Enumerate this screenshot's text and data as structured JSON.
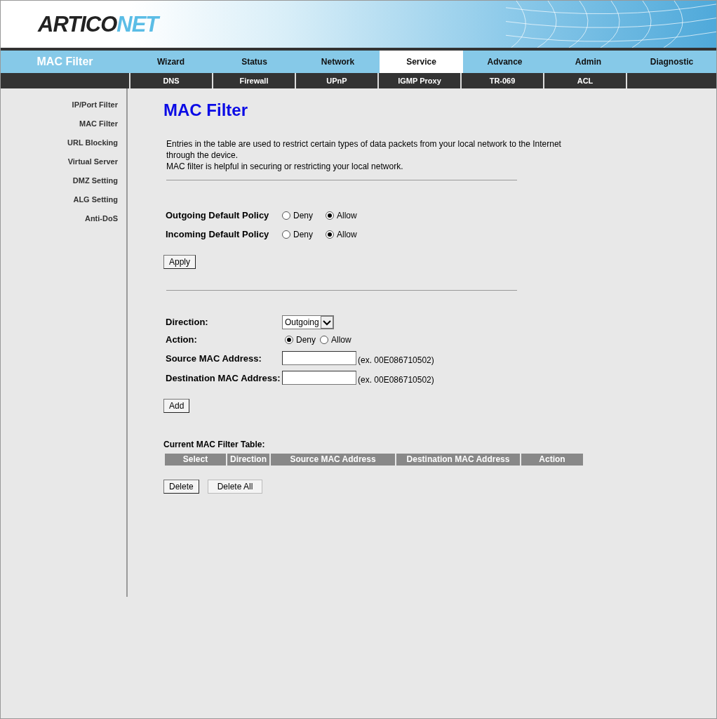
{
  "logo": {
    "dark": "ARTICO",
    "light": "NET"
  },
  "nav": {
    "section": "MAC Filter",
    "tabs": [
      {
        "label": "Wizard",
        "selected": false
      },
      {
        "label": "Status",
        "selected": false
      },
      {
        "label": "Network",
        "selected": false
      },
      {
        "label": "Service",
        "selected": true
      },
      {
        "label": "Advance",
        "selected": false
      },
      {
        "label": "Admin",
        "selected": false
      },
      {
        "label": "Diagnostic",
        "selected": false
      }
    ]
  },
  "subnav": [
    "DNS",
    "Firewall",
    "UPnP",
    "IGMP Proxy",
    "TR-069",
    "ACL"
  ],
  "sidebar": {
    "items": [
      "IP/Port Filter",
      "MAC Filter",
      "URL Blocking",
      "Virtual Server",
      "DMZ Setting",
      "ALG Setting",
      "Anti-DoS"
    ]
  },
  "title": "MAC Filter",
  "description": [
    "Entries in the table are used to restrict certain types of data packets from your local network to the Internet through the device.",
    "MAC filter is helpful in securing or restricting your local network."
  ],
  "policies": [
    {
      "label": "Outgoing Default Policy",
      "options": [
        {
          "label": "Deny",
          "selected": false
        },
        {
          "label": "Allow",
          "selected": true
        }
      ]
    },
    {
      "label": "Incoming Default Policy",
      "options": [
        {
          "label": "Deny",
          "selected": false
        },
        {
          "label": "Allow",
          "selected": true
        }
      ]
    }
  ],
  "apply_button": "Apply",
  "form": {
    "direction": {
      "label": "Direction:",
      "value": "Outgoing"
    },
    "action": {
      "label": "Action:",
      "options": [
        {
          "label": "Deny",
          "selected": true
        },
        {
          "label": "Allow",
          "selected": false
        }
      ]
    },
    "fields": [
      {
        "label": "Source MAC Address:",
        "hint": "(ex. 00E086710502)"
      },
      {
        "label": "Destination MAC Address:",
        "hint": "(ex. 00E086710502)"
      }
    ]
  },
  "add_button": "Add",
  "table": {
    "title": "Current MAC Filter Table:",
    "columns": [
      "Select",
      "Direction",
      "Source MAC Address",
      "Destination MAC Address",
      "Action"
    ]
  },
  "buttons": [
    "Delete",
    "Delete All"
  ]
}
